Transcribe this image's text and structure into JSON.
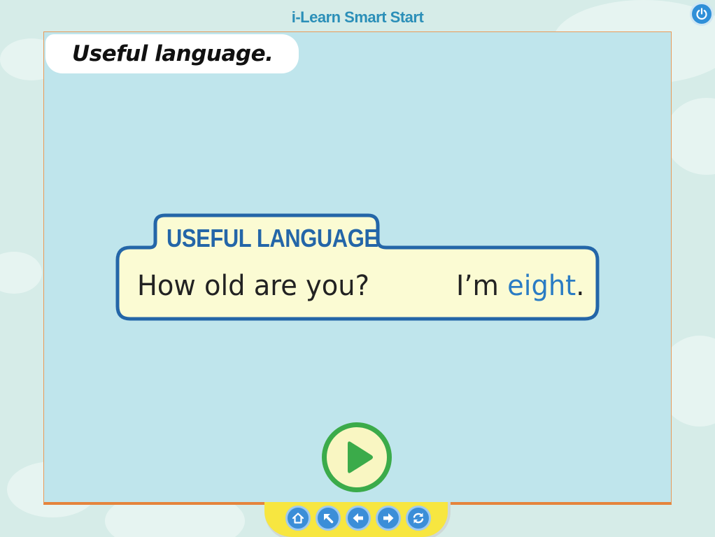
{
  "header": {
    "app_title": "i-Learn Smart Start"
  },
  "slide": {
    "heading": "Useful language.",
    "useful_language": {
      "label": "USEFUL LANGUAGE",
      "question": "How old are you?",
      "answer_prefix": "I’m ",
      "answer_highlight": "eight",
      "answer_suffix": "."
    }
  },
  "icons": {
    "power": "power-icon",
    "play": "play-icon",
    "home": "home-icon",
    "back_to_menu": "arrow-up-left-icon",
    "previous": "arrow-left-icon",
    "next": "arrow-right-icon",
    "replay": "refresh-icon"
  },
  "colors": {
    "title": "#2b8fb8",
    "stage_bg": "#bfe5ec",
    "label_blue": "#2466a8",
    "highlight_blue": "#2a7cc4",
    "play_green": "#3bab4a",
    "nav_yellow": "#f7e640",
    "nav_button": "#3b8ed8"
  }
}
